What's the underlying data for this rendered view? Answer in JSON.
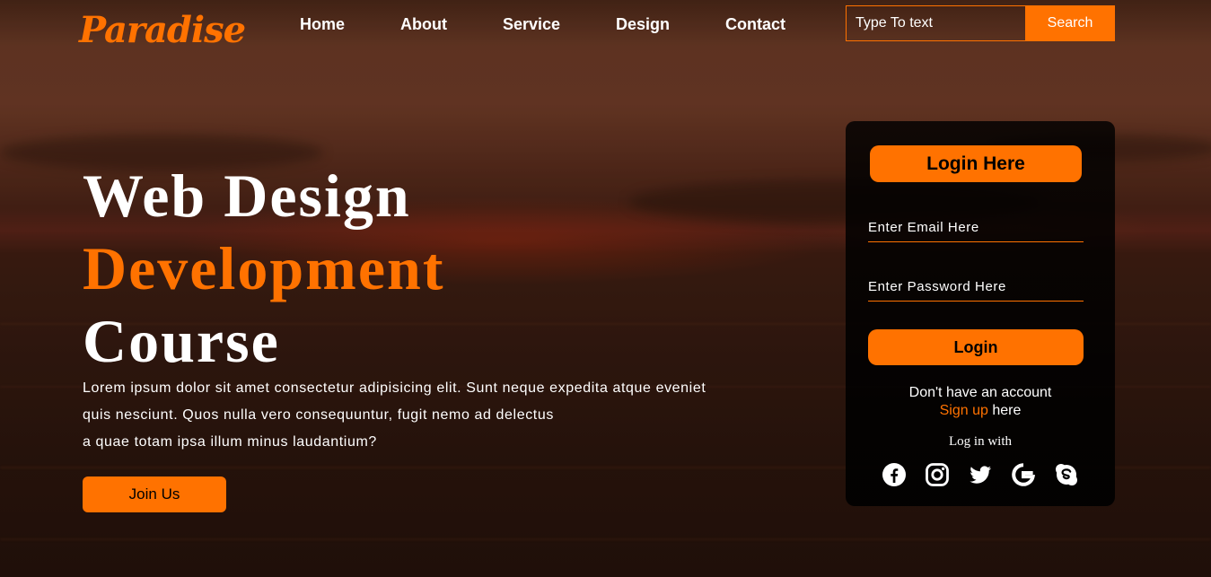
{
  "brand": {
    "logo": "Paradise",
    "accent_color": "#ff7200"
  },
  "nav": {
    "items": [
      {
        "label": "Home"
      },
      {
        "label": "About"
      },
      {
        "label": "Service"
      },
      {
        "label": "Design"
      },
      {
        "label": "Contact"
      }
    ]
  },
  "search": {
    "placeholder": "Type To text",
    "button_label": "Search"
  },
  "hero": {
    "line1": "Web Design",
    "line2": "Development",
    "line3": "Course",
    "text_lines": [
      "Lorem ipsum dolor sit amet consectetur adipisicing elit. Sunt neque expedita atque eveniet",
      "quis nesciunt. Quos nulla vero consequuntur, fugit nemo ad delectus",
      "a quae totam ipsa illum minus laudantium?"
    ],
    "join_label": "Join Us"
  },
  "login": {
    "title": "Login Here",
    "email_placeholder": "Enter Email Here",
    "password_placeholder": "Enter Password Here",
    "button_label": "Login",
    "no_account_text": "Don't have an account",
    "signup_link": "Sign up",
    "signup_suffix": " here",
    "login_with": "Log in with",
    "socials": [
      {
        "icon": "facebook-icon"
      },
      {
        "icon": "instagram-icon"
      },
      {
        "icon": "twitter-icon"
      },
      {
        "icon": "google-icon"
      },
      {
        "icon": "skype-icon"
      }
    ]
  }
}
